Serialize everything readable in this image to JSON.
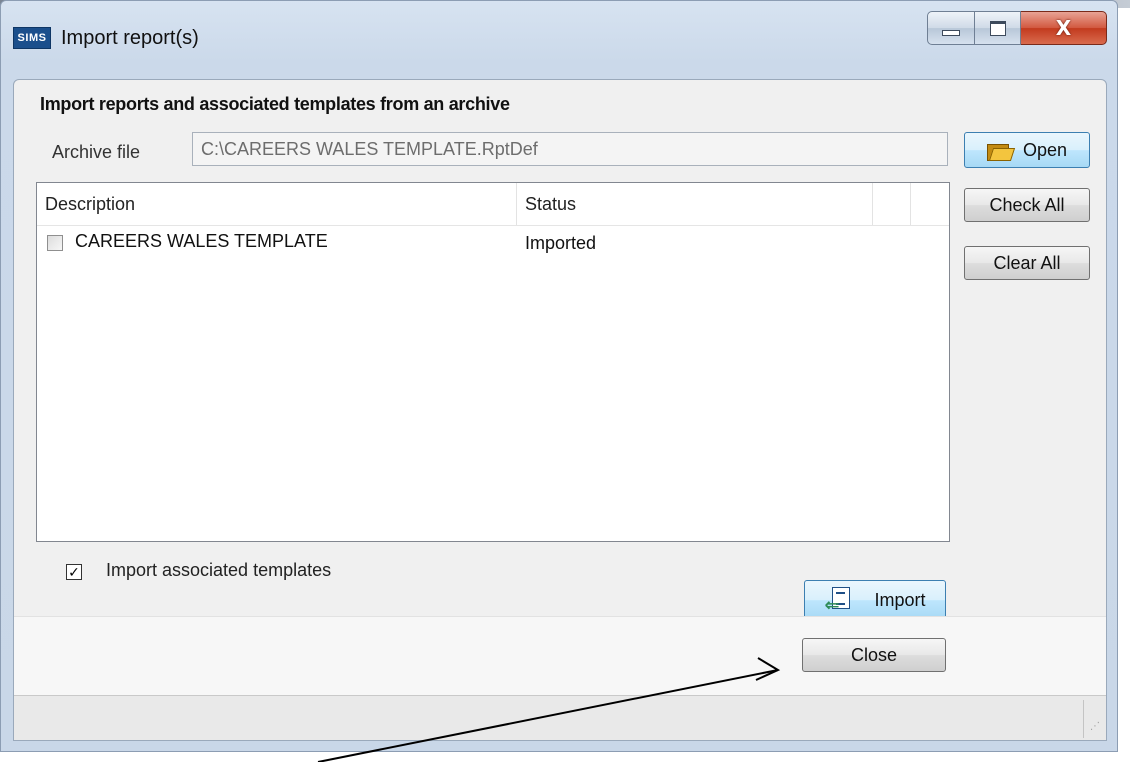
{
  "window": {
    "title": "Import report(s)",
    "logo_text": "SIMS",
    "minimize_icon": "minimize-icon",
    "maximize_icon": "maximize-icon",
    "close_icon": "close-icon",
    "close_glyph": "X"
  },
  "main": {
    "heading": "Import reports and associated templates from an archive",
    "archive_label": "Archive file",
    "archive_value": "C:\\CAREERS WALES TEMPLATE.RptDef"
  },
  "buttons": {
    "open": "Open",
    "check_all": "Check All",
    "clear_all": "Clear All",
    "import": "Import",
    "close": "Close"
  },
  "table": {
    "columns": [
      "Description",
      "Status"
    ],
    "rows": [
      {
        "description": "CAREERS WALES TEMPLATE",
        "status": "Imported",
        "checked": false
      }
    ]
  },
  "options": {
    "import_templates_label": "Import associated templates",
    "import_templates_checked": true,
    "check_glyph": "✓"
  },
  "colors": {
    "accent_button_border": "#3c7fb1",
    "close_button_red": "#c23a1e",
    "logo_blue": "#1b4f8c"
  }
}
